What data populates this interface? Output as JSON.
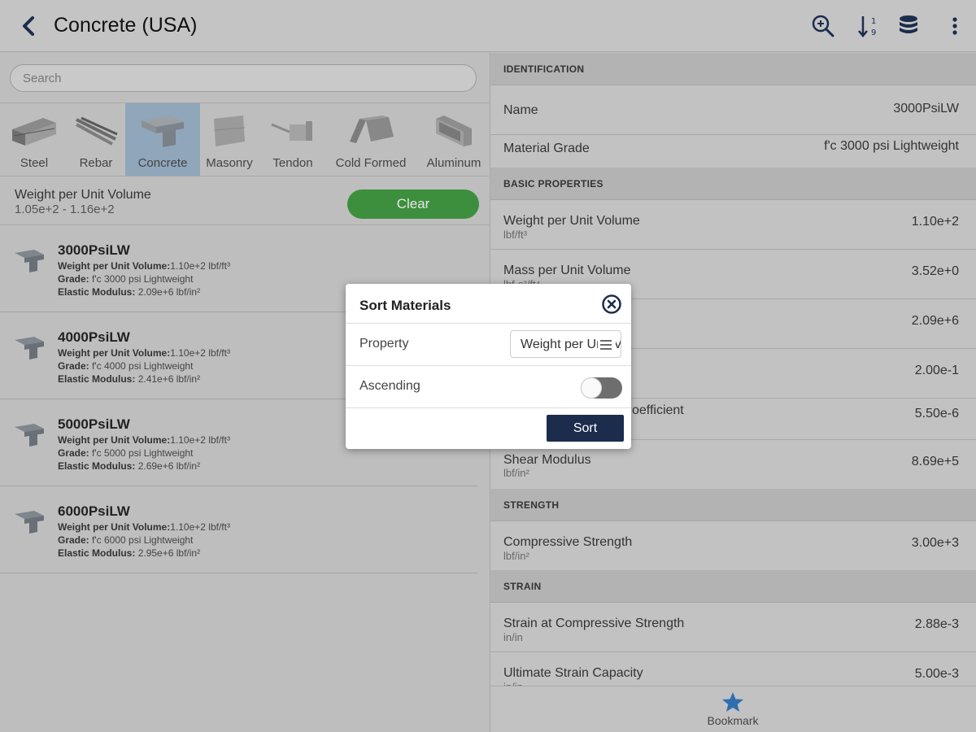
{
  "header": {
    "title": "Concrete (USA)"
  },
  "search": {
    "placeholder": "Search"
  },
  "categories": [
    {
      "label": "Steel"
    },
    {
      "label": "Rebar"
    },
    {
      "label": "Concrete"
    },
    {
      "label": "Masonry"
    },
    {
      "label": "Tendon"
    },
    {
      "label": "Cold Formed"
    },
    {
      "label": "Aluminum"
    }
  ],
  "active_category": "Concrete",
  "filter": {
    "name": "Weight per Unit Volume",
    "range": "1.05e+2 - 1.16e+2",
    "clear_label": "Clear"
  },
  "labels": {
    "weight": "Weight per Unit Volume:",
    "grade": "Grade:",
    "elastic": "Elastic Modulus:"
  },
  "materials": [
    {
      "name": "3000PsiLW",
      "weight": "1.10e+2 lbf/ft³",
      "grade": "f'c 3000 psi Lightweight",
      "elastic": "2.09e+6 lbf/in²"
    },
    {
      "name": "4000PsiLW",
      "weight": "1.10e+2 lbf/ft³",
      "grade": "f'c 4000 psi Lightweight",
      "elastic": "2.41e+6 lbf/in²"
    },
    {
      "name": "5000PsiLW",
      "weight": "1.10e+2 lbf/ft³",
      "grade": "f'c 5000 psi Lightweight",
      "elastic": "2.69e+6 lbf/in²"
    },
    {
      "name": "6000PsiLW",
      "weight": "1.10e+2 lbf/ft³",
      "grade": "f'c 6000 psi Lightweight",
      "elastic": "2.95e+6 lbf/in²"
    }
  ],
  "details": {
    "identification": {
      "header": "IDENTIFICATION",
      "rows": [
        {
          "label": "Name",
          "value": "3000PsiLW"
        },
        {
          "label": "Material Grade",
          "value": "f'c 3000 psi Lightweight"
        }
      ]
    },
    "basic": {
      "header": "BASIC PROPERTIES",
      "rows": [
        {
          "label": "Weight per Unit Volume",
          "unit": "lbf/ft³",
          "value": "1.10e+2"
        },
        {
          "label": "Mass per Unit Volume",
          "unit": "lbf-s²/ft⁴",
          "value": "3.52e+0"
        },
        {
          "label": "",
          "unit": "",
          "value": "2.09e+6"
        },
        {
          "label": "",
          "unit": "",
          "value": "2.00e-1"
        },
        {
          "label": "oefficient",
          "unit": "",
          "value": "5.50e-6"
        },
        {
          "label": "Shear Modulus",
          "unit": "lbf/in²",
          "value": "8.69e+5"
        }
      ]
    },
    "strength": {
      "header": "STRENGTH",
      "rows": [
        {
          "label": "Compressive Strength",
          "unit": "lbf/in²",
          "value": "3.00e+3"
        }
      ]
    },
    "strain": {
      "header": "STRAIN",
      "rows": [
        {
          "label": "Strain at Compressive Strength",
          "unit": "in/in",
          "value": "2.88e-3"
        },
        {
          "label": "Ultimate Strain Capacity",
          "unit": "in/in",
          "value": "5.00e-3"
        }
      ]
    }
  },
  "bookmark": {
    "label": "Bookmark"
  },
  "dialog": {
    "title": "Sort Materials",
    "property_label": "Property",
    "property_value": "Weight per Unit Volume",
    "ascending_label": "Ascending",
    "ascending": false,
    "sort_label": "Sort"
  },
  "colors": {
    "active_category": "#8fa6bb",
    "clear_button": "#3d8f3d",
    "sort_button": "#1b2c4d",
    "bookmark_star": "#2f6fb0"
  },
  "icons": {
    "back": "chevron-left-icon",
    "zoom": "zoom-search-icon",
    "sort": "sort-numeric-icon",
    "database": "database-icon",
    "more": "more-vertical-icon",
    "close": "close-circle-icon",
    "menu": "menu-icon",
    "bookmark": "star-icon"
  }
}
